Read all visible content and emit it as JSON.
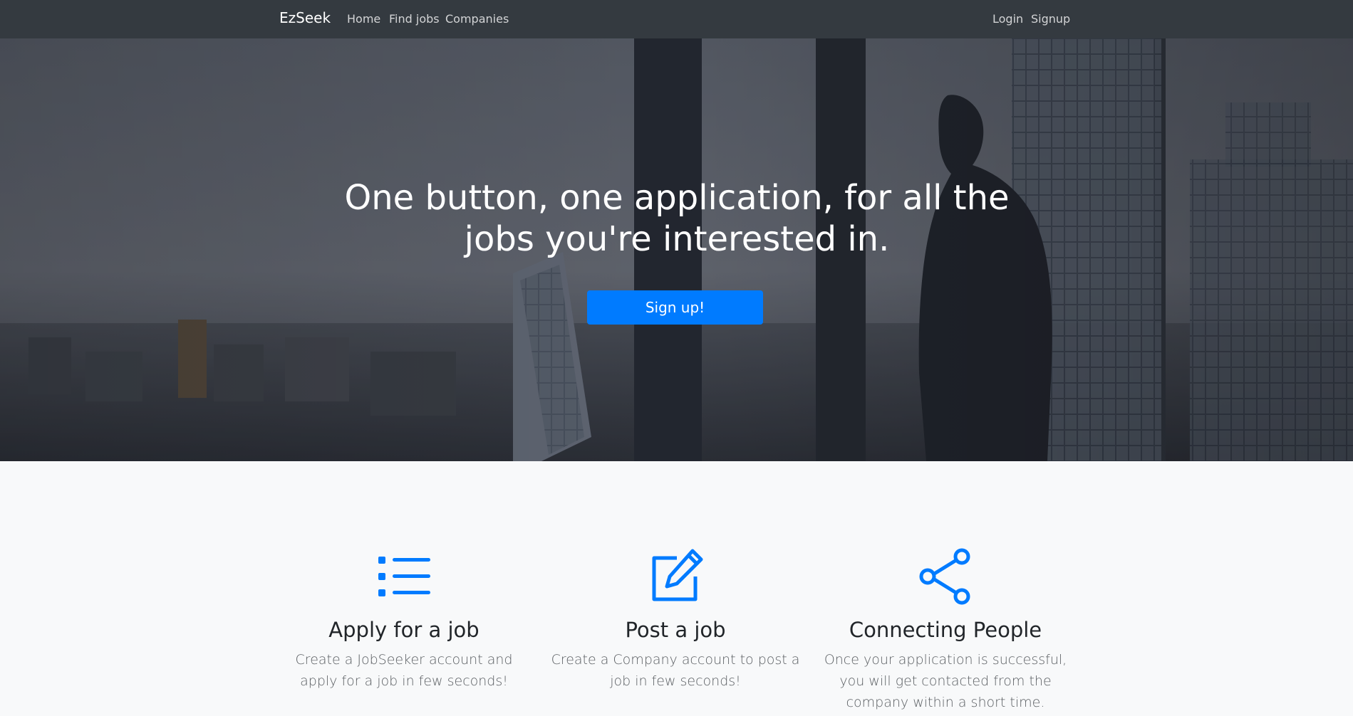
{
  "navbar": {
    "brand": "EzSeek",
    "left_links": [
      "Home",
      "Find jobs",
      "Companies"
    ],
    "right_links": [
      "Login",
      "Signup"
    ]
  },
  "hero": {
    "headline_line1": "One button, one application, for all the",
    "headline_line2": "jobs you're interested in.",
    "cta_label": "Sign up!",
    "accent_color": "#007bff"
  },
  "features": [
    {
      "icon": "list-icon",
      "title": "Apply for a job",
      "text_line1": "Create a JobSeeker account and",
      "text_line2": "apply for a job in few seconds!"
    },
    {
      "icon": "edit-icon",
      "title": "Post a job",
      "text_line1": "Create a Company account to post a",
      "text_line2": "job in few seconds!"
    },
    {
      "icon": "share-icon",
      "title": "Connecting People",
      "text_line1": "Once your application is successful,",
      "text_line2": "you will get contacted from the",
      "text_line3": "company within a short time."
    }
  ]
}
